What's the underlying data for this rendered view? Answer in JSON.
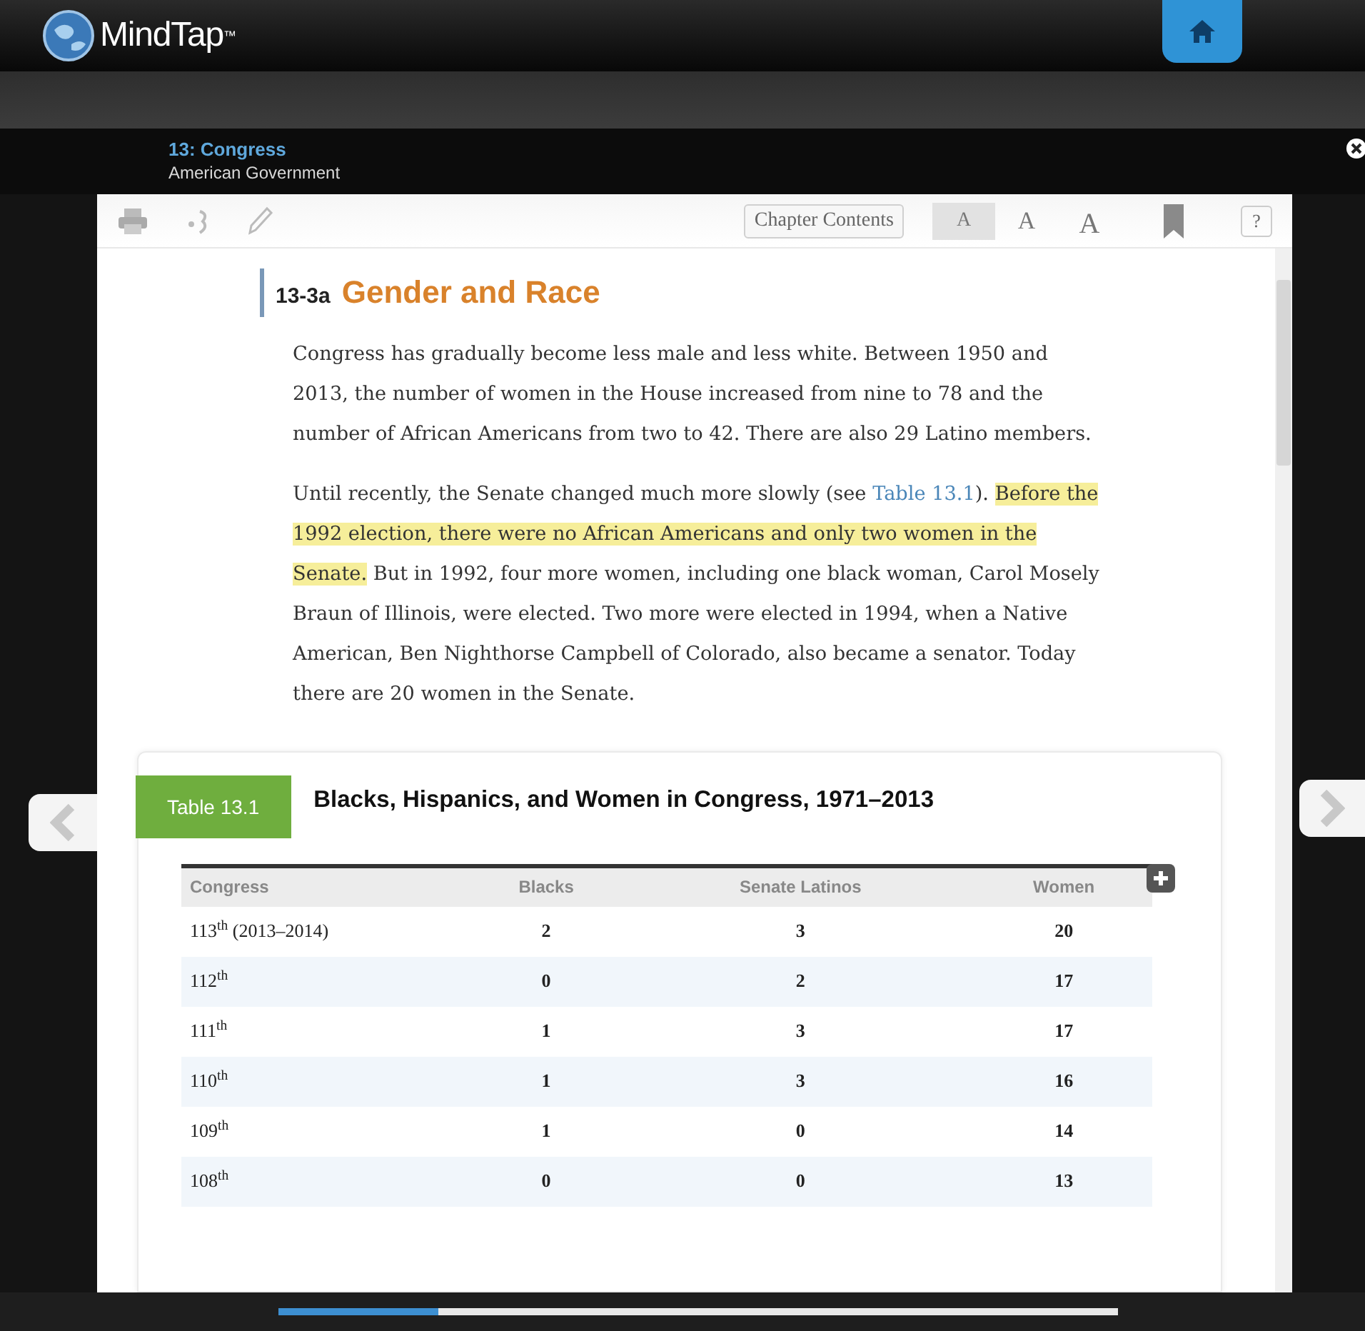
{
  "app": {
    "logo": "MindTap",
    "trademark": "™"
  },
  "chapter": {
    "title": "13: Congress",
    "subtitle": "American Government"
  },
  "toolbar": {
    "chapter_contents": "Chapter Contents",
    "font_sizes": [
      {
        "label": "A",
        "selected": true
      },
      {
        "label": "A",
        "selected": false
      },
      {
        "label": "A",
        "selected": false
      }
    ],
    "help": "?"
  },
  "section": {
    "number": "13-3a",
    "title": "Gender and Race"
  },
  "paragraphs": [
    [
      {
        "kind": "plain",
        "text": "Congress has gradually become less male and less white. Between 1950 and 2013, the number of women in the House increased from nine to 78 and the number of African Americans from two to 42. There are also 29 Latino members."
      }
    ],
    [
      {
        "kind": "plain",
        "text": "Until recently, the Senate changed much more slowly (see "
      },
      {
        "kind": "link",
        "text": "Table 13.1"
      },
      {
        "kind": "plain",
        "text": "). "
      },
      {
        "kind": "highlight",
        "text": "Before the 1992 election, there were no African Americans and only two women in the Senate."
      },
      {
        "kind": "plain",
        "text": " But in 1992, four more women, including one black woman, Carol Mosely Braun of Illinois, were elected. Two more were elected in 1994, when a Native American, Ben Nighthorse Campbell of Colorado, also became a senator. Today there are 20 women in the Senate."
      }
    ]
  ],
  "table": {
    "label": "Table 13.1",
    "title": "Blacks, Hispanics, and Women in Congress, 1971–2013",
    "columns": [
      "Congress",
      "Blacks",
      "Senate Latinos",
      "Women"
    ],
    "rows": [
      [
        "113$^{th}$ (2013–2014)",
        "2",
        "3",
        "20"
      ],
      [
        "112$^{th}$",
        "0",
        "2",
        "17"
      ],
      [
        "111$^{th}$",
        "1",
        "3",
        "17"
      ],
      [
        "110$^{th}$",
        "1",
        "3",
        "16"
      ],
      [
        "109$^{th}$",
        "1",
        "0",
        "14"
      ],
      [
        "108$^{th}$",
        "0",
        "0",
        "13"
      ]
    ]
  },
  "progress": {
    "level": 0.19
  }
}
